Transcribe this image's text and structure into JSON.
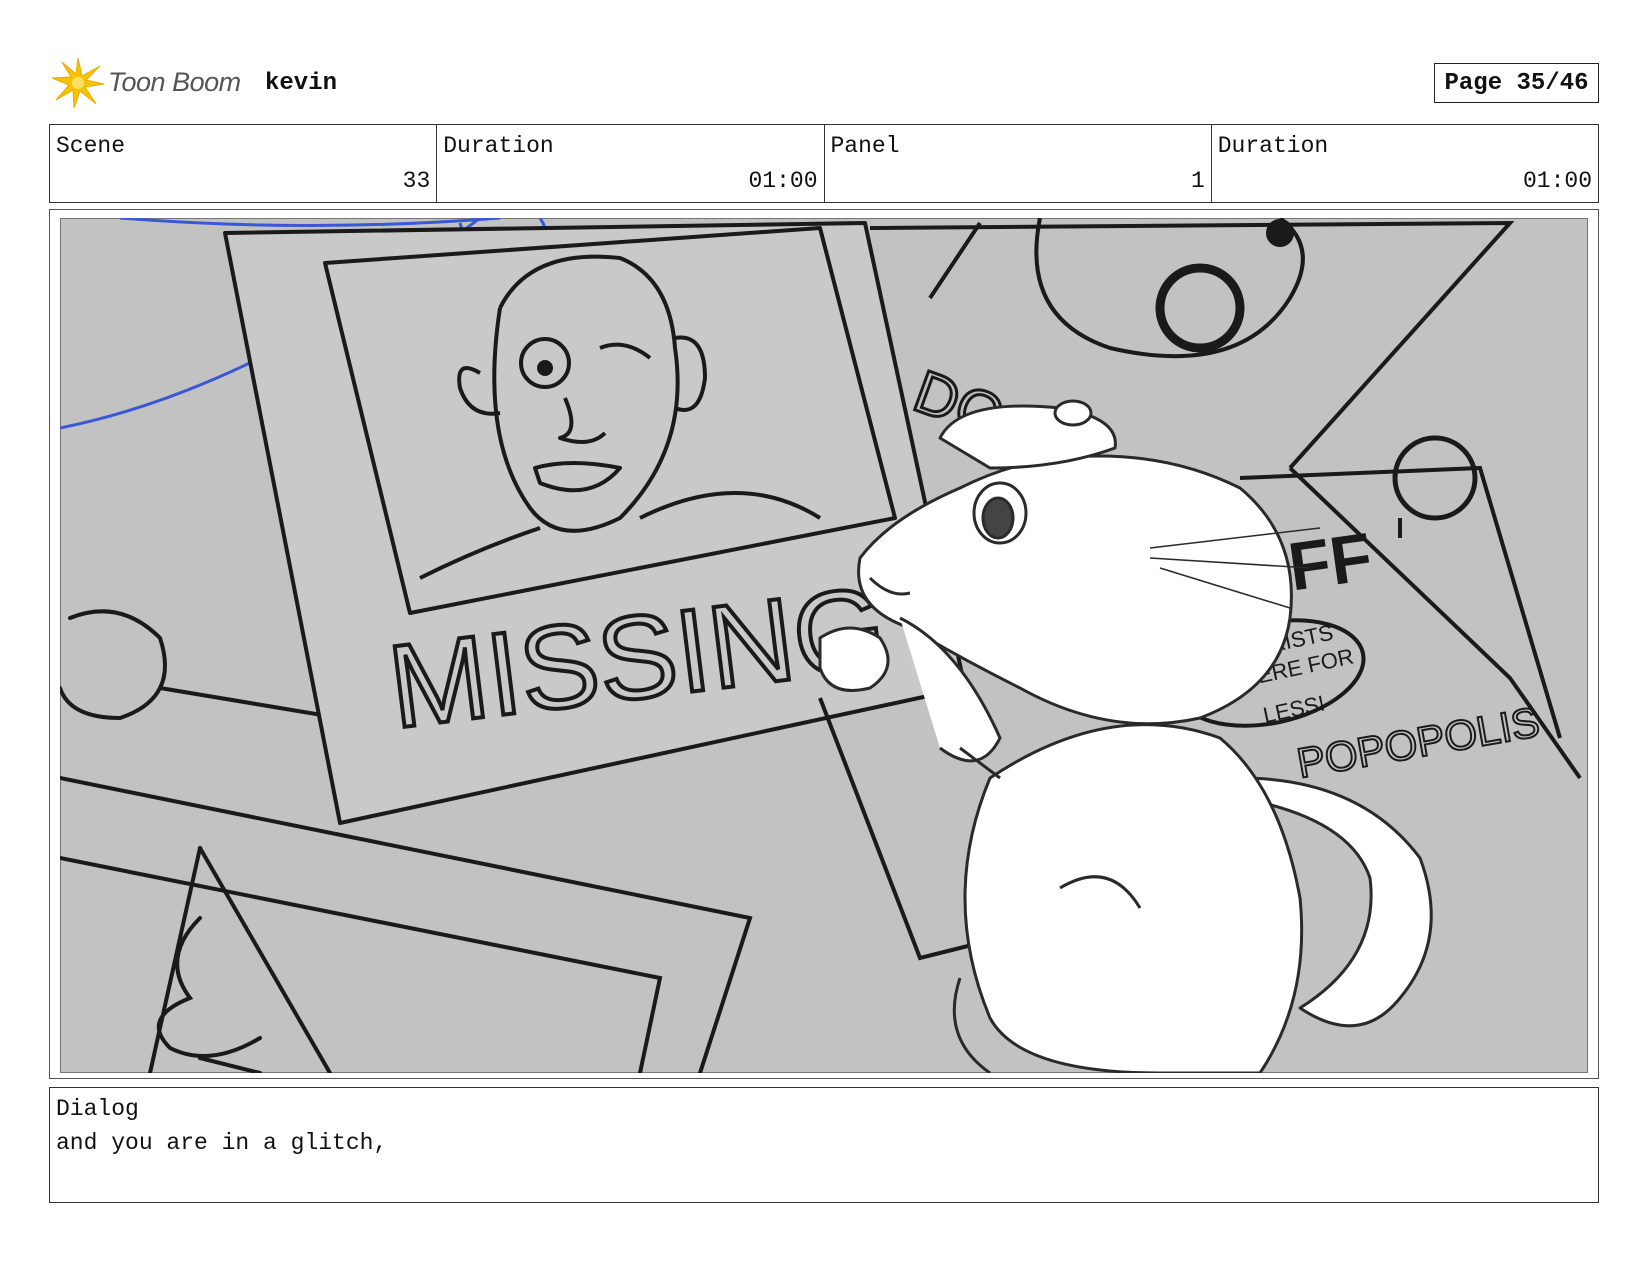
{
  "header": {
    "brand": "Toon Boom",
    "project": "kevin",
    "page": "Page 35/46"
  },
  "info": {
    "scene_label": "Scene",
    "scene_value": "33",
    "duration_label": "Duration",
    "duration_value": "01:00",
    "panel_label": "Panel",
    "panel_value": "1",
    "panel_duration_label": "Duration",
    "panel_duration_value": "01:00"
  },
  "drawing": {
    "missing_text": "MISSING",
    "off_text": "OFF",
    "bubble_line1": "IF IT EXISTS",
    "bubble_line2": "IT'S HERE FOR",
    "bubble_line3": "LESS!",
    "opolis_text": "POPOPOLIS",
    "dont_text": "DO N"
  },
  "dialog": {
    "label": "Dialog",
    "text": "and you are in a glitch,"
  }
}
